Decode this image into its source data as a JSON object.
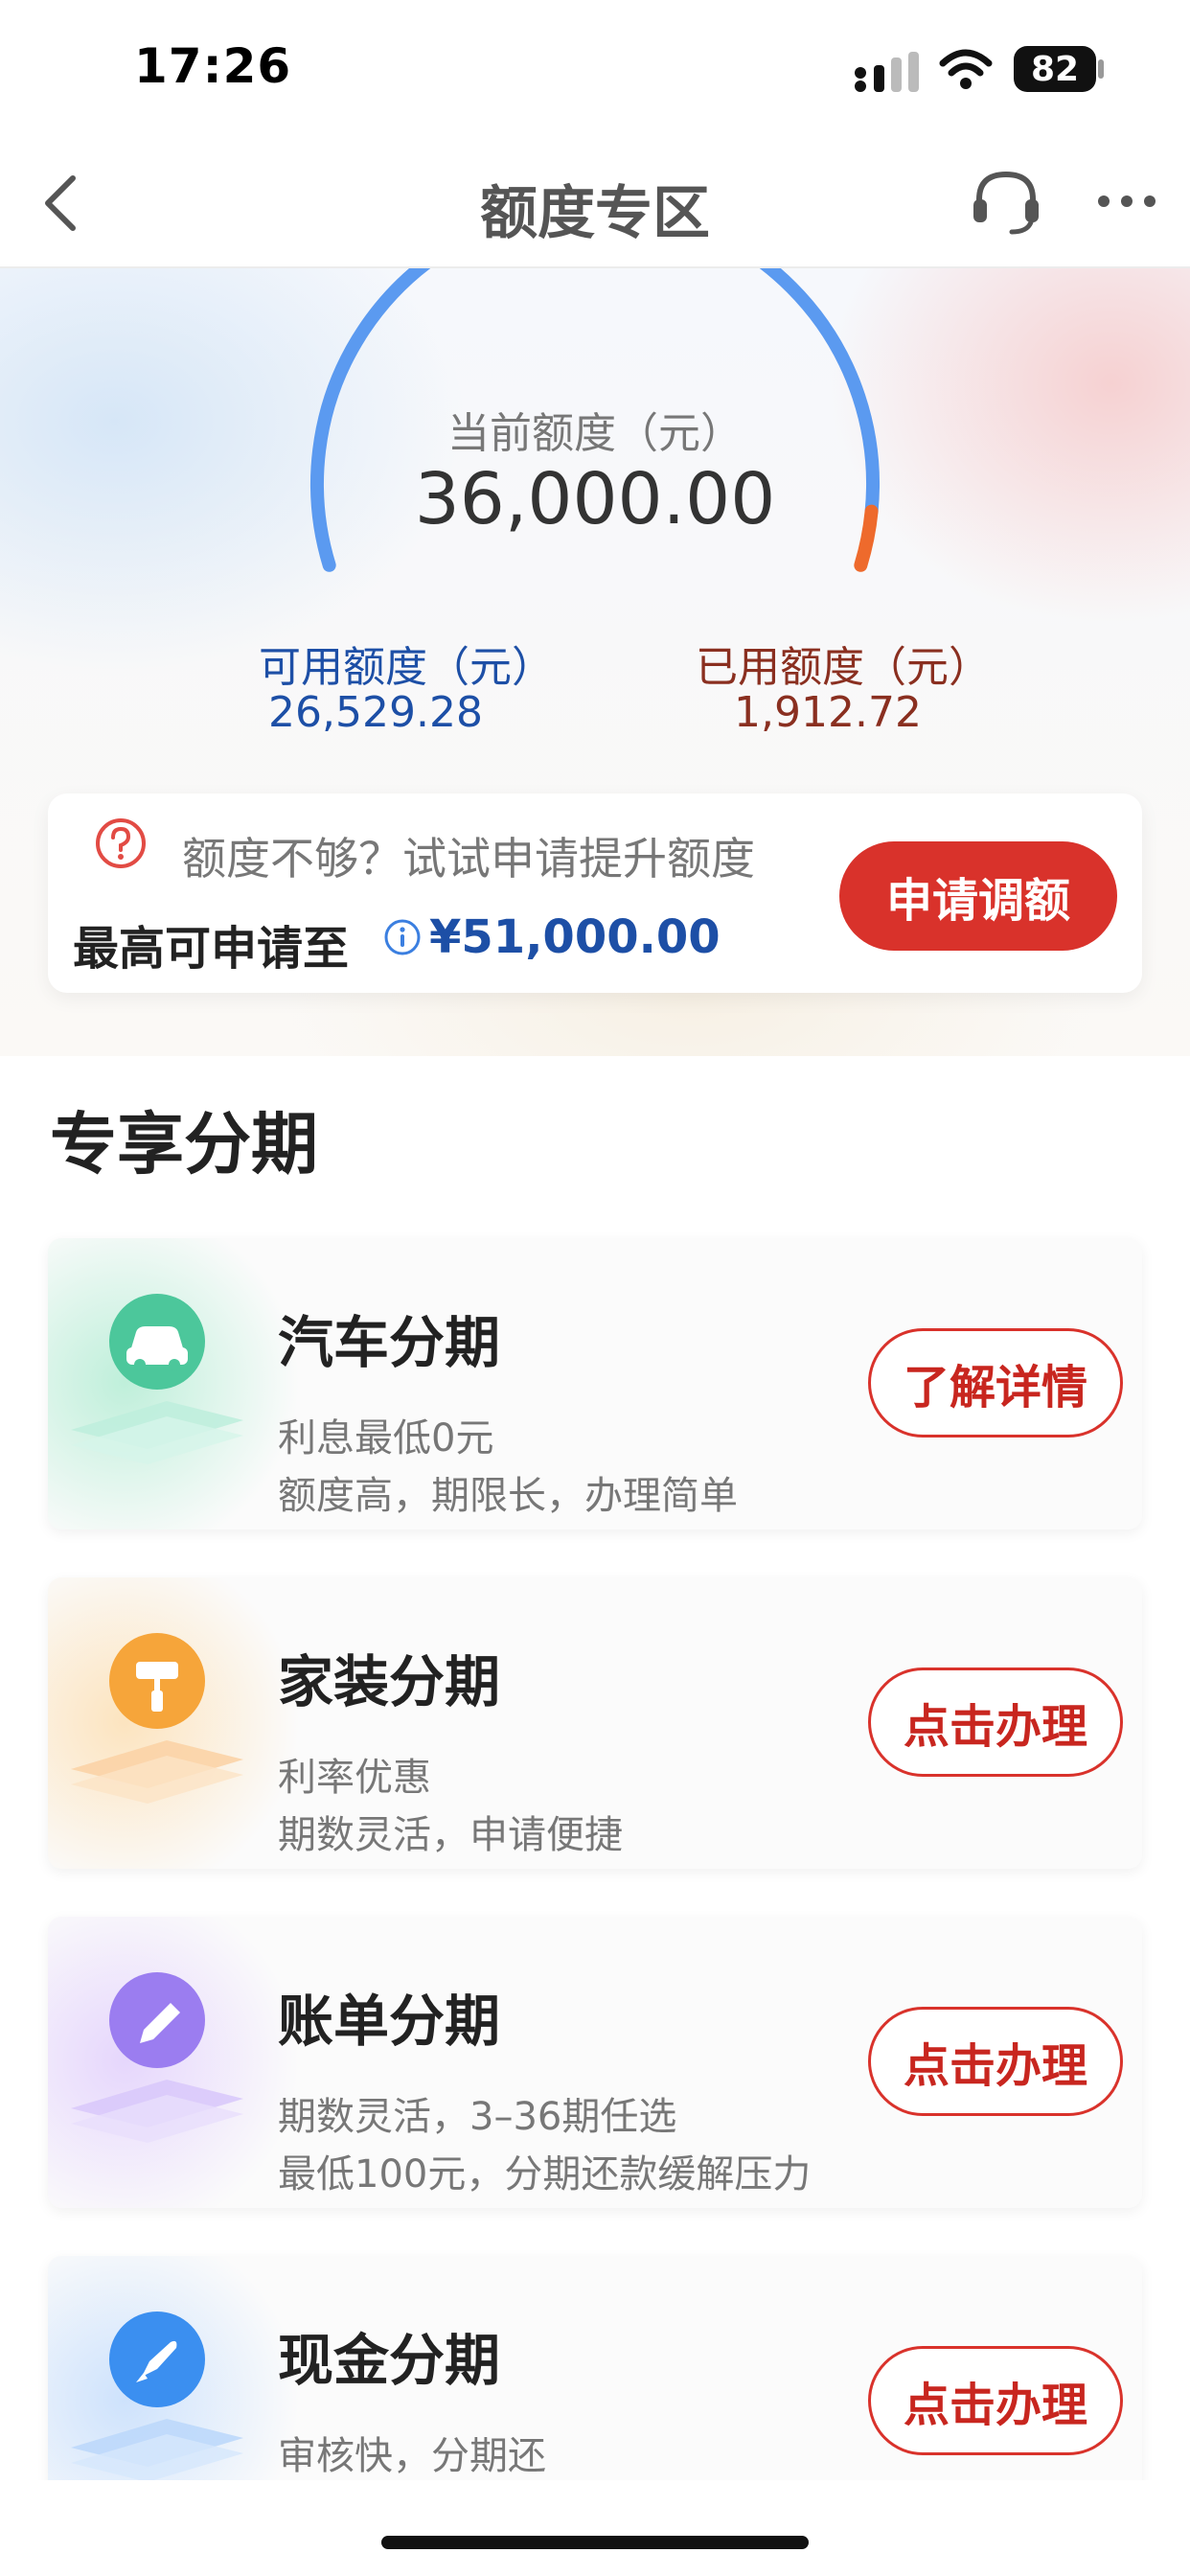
{
  "status_bar": {
    "time": "17:26",
    "battery": "82"
  },
  "nav": {
    "title": "额度专区"
  },
  "limit": {
    "current_label": "当前额度（元）",
    "current_value": "36,000.00",
    "available_label": "可用额度（元）",
    "available_value": "26,529.28",
    "used_label": "已用额度（元）",
    "used_value": "1,912.72",
    "used_fraction": 0.053
  },
  "raise": {
    "tip": "额度不够？试试申请提升额度",
    "max_label": "最高可申请至",
    "max_value": "¥51,000.00",
    "button": "申请调额"
  },
  "section": {
    "title": "专享分期"
  },
  "cards": [
    {
      "title": "汽车分期",
      "desc1": "利息最低0元",
      "desc2": "额度高，期限长，办理简单",
      "button": "了解详情",
      "icon": "car-icon",
      "color": "#4cc79b"
    },
    {
      "title": "家装分期",
      "desc1": "利率优惠",
      "desc2": "期数灵活，申请便捷",
      "button": "点击办理",
      "icon": "paint-roller-icon",
      "color": "#f6a53a"
    },
    {
      "title": "账单分期",
      "desc1": "期数灵活，3–36期任选",
      "desc2": "最低100元，分期还款缓解压力",
      "button": "点击办理",
      "icon": "pencil-icon",
      "color": "#9b7df0"
    },
    {
      "title": "现金分期",
      "desc1": "审核快，分期还",
      "desc2": "",
      "button": "点击办理",
      "icon": "rocket-icon",
      "color": "#3b8ff0"
    }
  ],
  "colors": {
    "accent_red": "#d9322b",
    "brand_blue": "#1d4fa6",
    "gauge_blue": "#5b9af0",
    "gauge_orange": "#ee6a2c"
  }
}
